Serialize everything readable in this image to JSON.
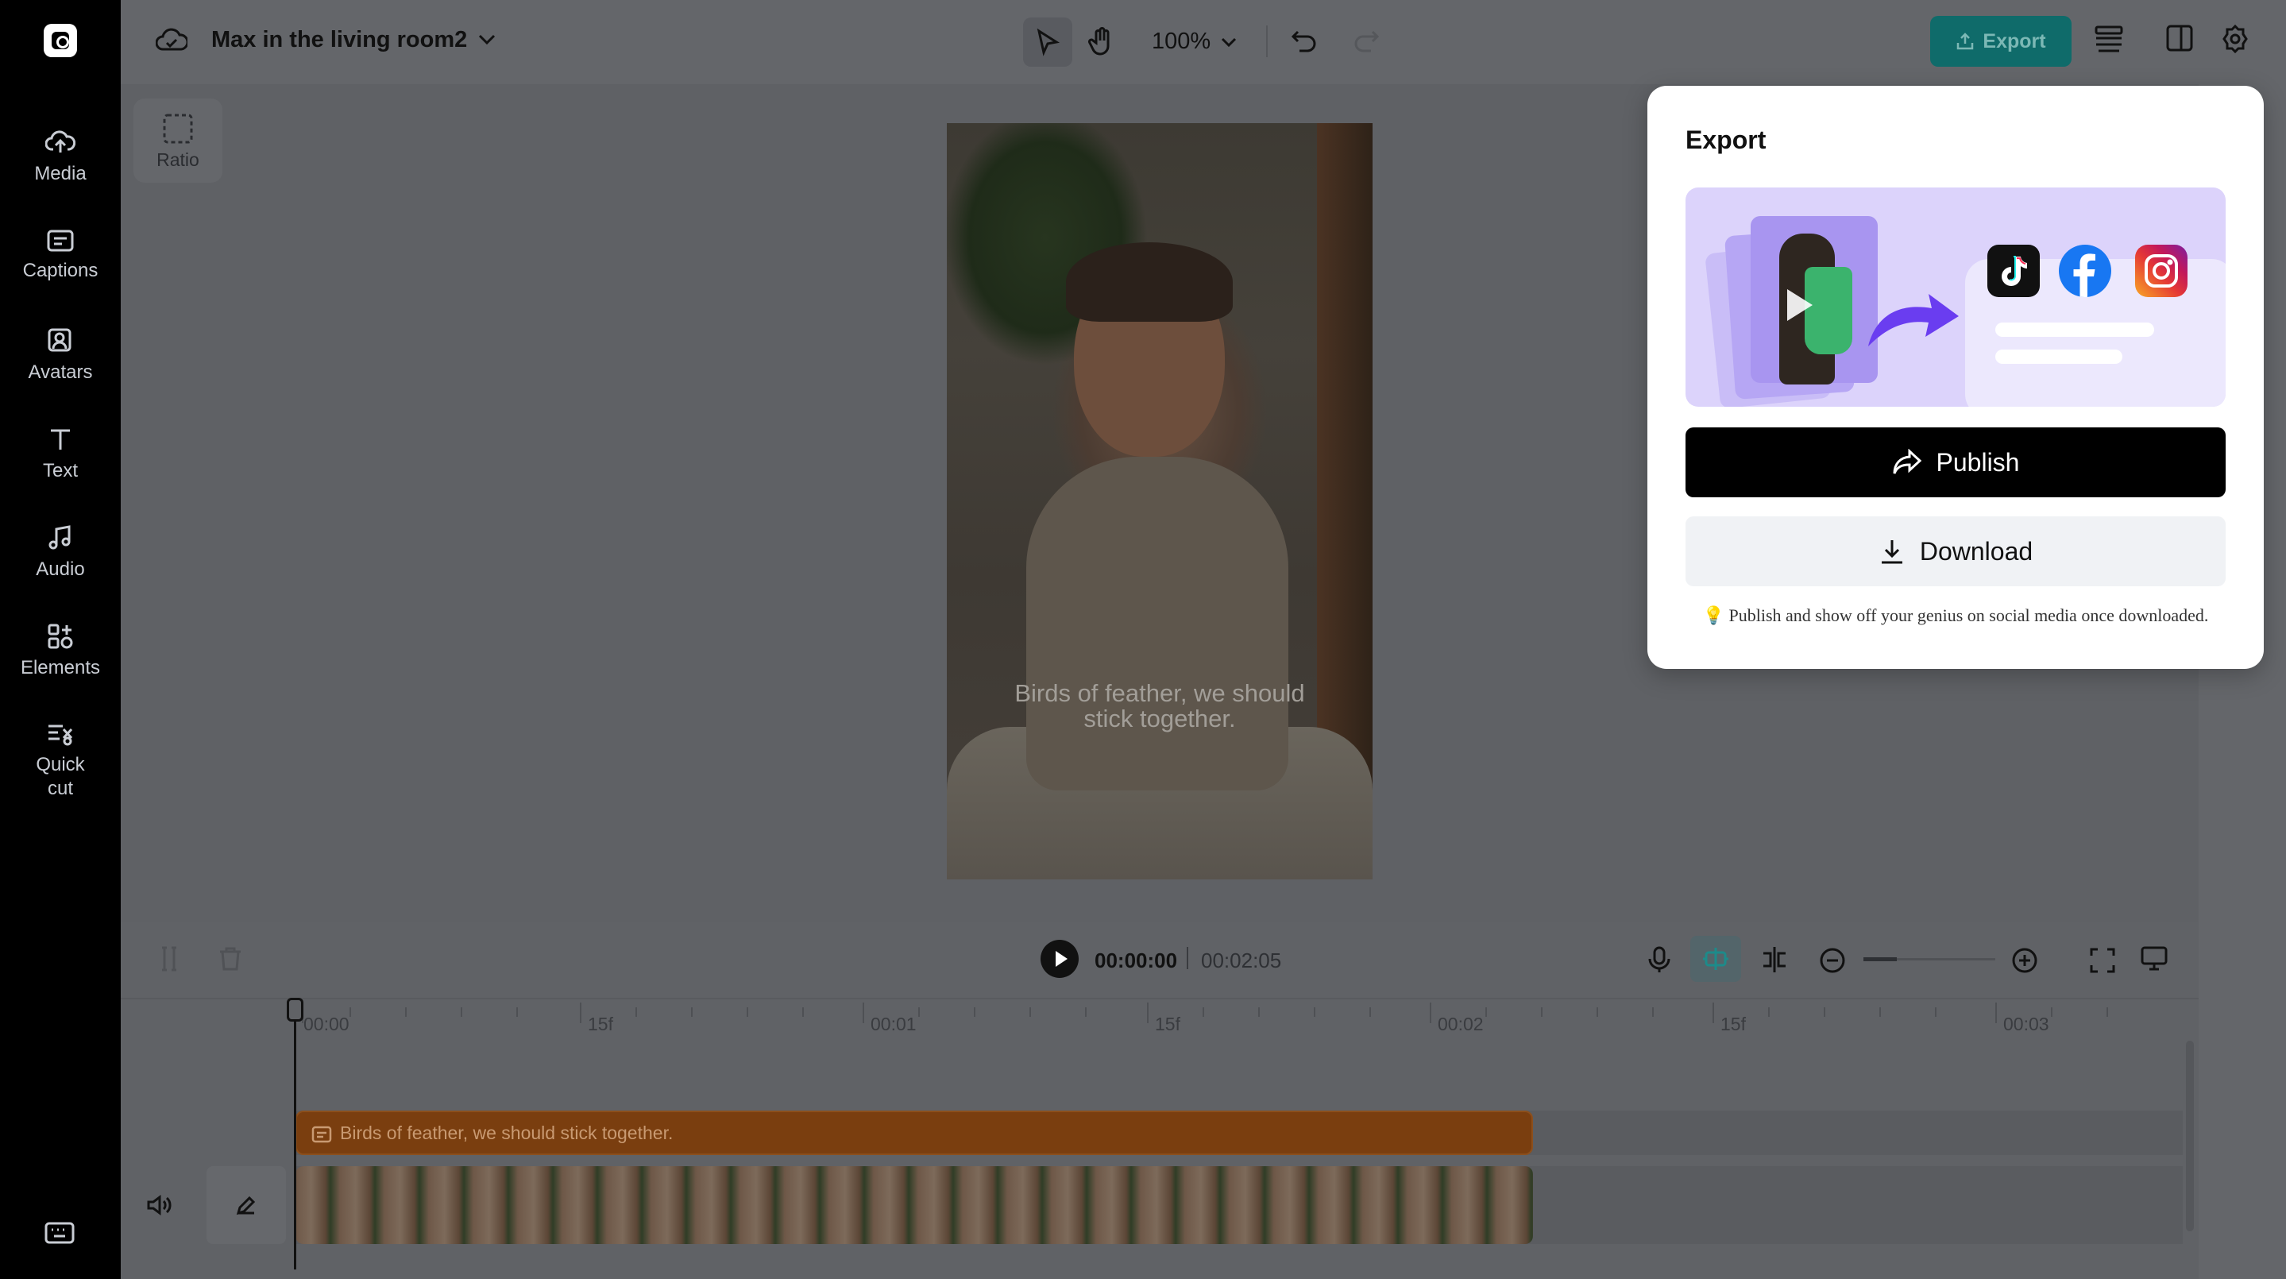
{
  "sidebar": {
    "items": [
      {
        "label": "Media",
        "icon": "cloud-upload-icon"
      },
      {
        "label": "Captions",
        "icon": "captions-icon"
      },
      {
        "label": "Avatars",
        "icon": "avatar-icon"
      },
      {
        "label": "Text",
        "icon": "text-icon"
      },
      {
        "label": "Audio",
        "icon": "music-note-icon"
      },
      {
        "label": "Elements",
        "icon": "elements-icon"
      },
      {
        "label": "Quick cut",
        "icon": "quick-cut-icon"
      }
    ]
  },
  "header": {
    "project_title": "Max in the living room2",
    "zoom": "100%",
    "export_label": "Export"
  },
  "canvas": {
    "ratio_label": "Ratio",
    "caption_line1": "Birds of feather, we should",
    "caption_line2": "stick together."
  },
  "timeline": {
    "current_time": "00:00:00",
    "total_time": "00:02:05",
    "ruler": [
      "00:00",
      "15f",
      "00:01",
      "15f",
      "00:02",
      "15f",
      "00:03"
    ],
    "caption_track_text": "Birds of feather, we should stick together."
  },
  "export_popup": {
    "title": "Export",
    "publish_label": "Publish",
    "download_label": "Download",
    "tip": "💡 Publish and show off your genius on social media once downloaded."
  },
  "colors": {
    "accent": "#0f6b6a",
    "caption_track": "#7a3e0f",
    "facebook": "#1877f2"
  }
}
